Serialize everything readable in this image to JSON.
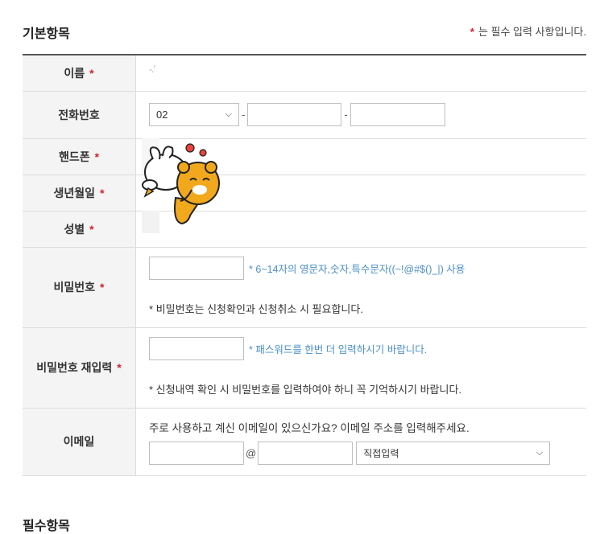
{
  "section1": {
    "title": "기본항목",
    "required_note_star": "*",
    "required_note": "는 필수 입력 사항입니다."
  },
  "fields": {
    "name": {
      "label": "이름",
      "required_mark": "*",
      "value": "-.’"
    },
    "phone": {
      "label": "전화번호",
      "area_code": "02",
      "sep1": "-",
      "sep2": "-"
    },
    "mobile": {
      "label": "핸드폰",
      "required_mark": "*"
    },
    "birthdate": {
      "label": "생년월일",
      "required_mark": "*"
    },
    "gender": {
      "label": "성별",
      "required_mark": "*"
    },
    "password": {
      "label": "비밀번호",
      "required_mark": "*",
      "hint": "* 6~14자의 영문자,숫자,특수문자((~!@#$()_|) 사용",
      "note": "* 비밀번호는 신청확인과 신청취소 시 필요합니다."
    },
    "password_confirm": {
      "label": "비밀번호 재입력",
      "required_mark": "*",
      "hint": "* 패스워드를 한번 더 입력하시기 바랍니다.",
      "note": "* 신청내역 확인 시 비밀번호를 입력하여야 하니 꼭 기억하시기 바랍니다."
    },
    "email": {
      "label": "이메일",
      "prompt": "주로 사용하고 계신 이메일이 있으신가요? 이메일 주소를 입력해주세요.",
      "at": "@",
      "domain_select": "직접입력"
    }
  },
  "section2": {
    "title": "필수항목"
  },
  "icons": {
    "select_arrow": "chevron-down-icon",
    "sticker": "character-sticker"
  }
}
